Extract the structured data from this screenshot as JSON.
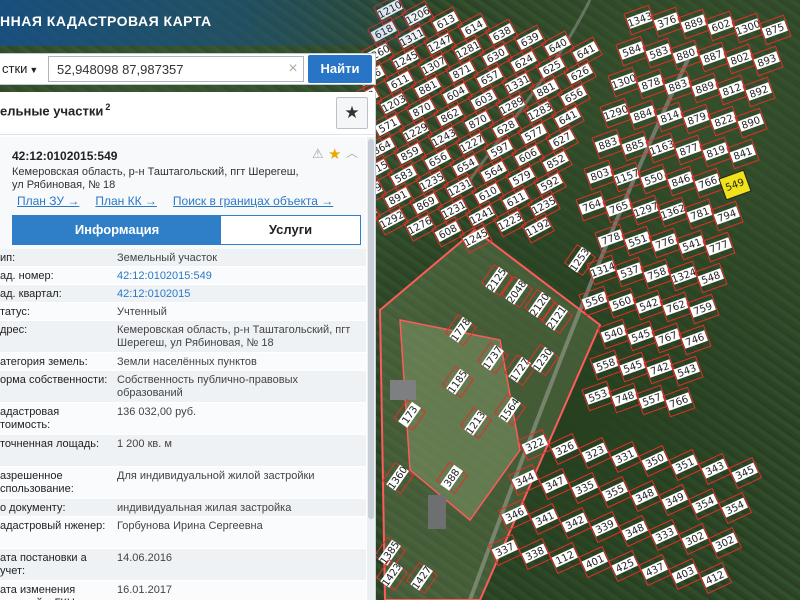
{
  "header": {
    "title": "ННАЯ КАДАСТРОВАЯ КАРТА"
  },
  "search": {
    "mode_label": "стки",
    "query": "52,948098 87,987357",
    "clear_icon": "close-icon",
    "find_label": "Найти"
  },
  "panel": {
    "title": "ельные участки",
    "count": "2",
    "favorite_icon": "star-icon"
  },
  "card": {
    "cad_number": "42:12:0102015:549",
    "address": "Кемеровская область, р-н Таштагольский, пгт Шерегеш, ул Рябиновая, № 18",
    "links": [
      "План ЗУ →",
      "План КК →",
      "Поиск в границах объекта →"
    ],
    "tabs": {
      "active": "Информация",
      "other": "Услуги"
    },
    "rows": [
      {
        "k": "ип:",
        "v": "Земельный участок",
        "h": 18
      },
      {
        "k": "ад. номер:",
        "v": "42:12:0102015:549",
        "h": 18,
        "link": true
      },
      {
        "k": "ад. квартал:",
        "v": "42:12:0102015",
        "h": 18,
        "link": true
      },
      {
        "k": "татус:",
        "v": "Учтенный",
        "h": 18
      },
      {
        "k": "дрес:",
        "v": "Кемеровская область, р-н Таштагольский, пгт Шерегеш, ул Рябиновая, № 18",
        "h": 32
      },
      {
        "k": "атегория земель:",
        "v": "Земли населённых пунктов",
        "h": 18
      },
      {
        "k": "орма собственности:",
        "v": "Собственность публично-правовых образований",
        "h": 32
      },
      {
        "k": "адастровая тоимость:",
        "v": "136 032,00 руб.",
        "h": 32
      },
      {
        "k": "точненная лощадь:",
        "v": "1 200 кв. м",
        "h": 32
      },
      {
        "k": "азрешенное спользование:",
        "v": "Для индивидуальной жилой застройки",
        "h": 32
      },
      {
        "k": "о документу:",
        "v": "индивидуальная жилая застройка",
        "h": 18
      },
      {
        "k": "адастровый нженер:",
        "v": "Горбунова Ирина Сергеевна",
        "h": 32
      },
      {
        "k": "ата постановки а учет:",
        "v": "14.06.2016",
        "h": 32
      },
      {
        "k": "ата изменения ведений в ГКН:",
        "v": "16.01.2017",
        "h": 32
      }
    ]
  },
  "map": {
    "highlight_color": "#f2e21a",
    "boundary_color": "#e0302c",
    "highlighted_plot": "549",
    "plots": [
      "1210",
      "1206",
      "613",
      "614",
      "638",
      "639",
      "640",
      "641",
      "618",
      "1311",
      "1247",
      "1281",
      "630",
      "624",
      "625",
      "626",
      "1260",
      "1245",
      "1307",
      "871",
      "657",
      "1331",
      "881",
      "656",
      "636",
      "611",
      "881",
      "604",
      "603",
      "1289",
      "1283",
      "641",
      "658",
      "1203",
      "870",
      "862",
      "870",
      "628",
      "577",
      "627",
      "1239",
      "571",
      "1229",
      "1243",
      "1227",
      "597",
      "606",
      "852",
      "1209",
      "864",
      "859",
      "656",
      "654",
      "564",
      "579",
      "592",
      "1228",
      "1215",
      "583",
      "1235",
      "1231",
      "610",
      "611",
      "1235",
      "420",
      "1269",
      "891",
      "869",
      "1231",
      "1241",
      "1223",
      "1192",
      "866",
      "1205",
      "1292",
      "1276",
      "608",
      "1245",
      "1233",
      "1239",
      "374",
      "360",
      "1226",
      "1244",
      "1216",
      "423",
      "379",
      "1250",
      "1311",
      "1297",
      "1313",
      "852",
      "1213",
      "1233",
      "1190",
      "1237",
      "1210",
      "1253",
      "1320",
      "1378",
      "1307",
      "1323",
      "1293",
      "1294",
      "1252",
      "1275",
      "1208",
      "1219",
      "1318",
      "1299",
      "1315",
      "1205",
      "1299",
      "1259",
      "1239",
      "1233",
      "1225",
      "1234",
      "1224",
      "1222",
      "1259",
      "1208",
      "1225",
      "1307",
      "1210",
      "1204",
      "1313",
      "1277",
      "254",
      "326",
      "357",
      "597",
      "592",
      "337",
      "313",
      "293",
      "330",
      "426",
      "381",
      "310",
      "209",
      "202",
      "255",
      "339",
      "1246",
      "1252",
      "1240",
      "241",
      "247",
      "303",
      "262",
      "214",
      "225",
      "205",
      "1212",
      "1309",
      "1211",
      "1303",
      "1283",
      "1265",
      "1203",
      "1263",
      "1201",
      "1298",
      "1206",
      "1213",
      "1290",
      "1264",
      "1222",
      "1219",
      "1202",
      "1212",
      "1209",
      "1308",
      "1203",
      "1210",
      "1267",
      "1271",
      "1214",
      "1221",
      "1236",
      "1290",
      "1242",
      "1221",
      "1280",
      "1266",
      "1260",
      "1292",
      "1244",
      "1205",
      "1308",
      "1307",
      "1327",
      "1311",
      "1239",
      "1204",
      "1231",
      "1213",
      "1238",
      "1226",
      "1296",
      "1284",
      "1205",
      "1233",
      "1274",
      "1314",
      "1251",
      "1320",
      "1316",
      "1302",
      "1318",
      "1270",
      "1219",
      "1327",
      "1280",
      "1256",
      "1300",
      "1212",
      "1269",
      "1222",
      "1297",
      "1249",
      "1273",
      "1317",
      "1302",
      "1295",
      "1315",
      "1276",
      "1315",
      "1211",
      "1322",
      "1282",
      "1278",
      "1230",
      "1276",
      "1252",
      "1201",
      "1205",
      "1288",
      "1230",
      "1296",
      "1275",
      "1306",
      "1294",
      "1244",
      "1322",
      "1234",
      "1300",
      "1254",
      "1303",
      "1298",
      "1279",
      "1233",
      "1242",
      "1220",
      "1211",
      "1284",
      "1304",
      "1281",
      "1319",
      "1221",
      "1272",
      "1211",
      "1284",
      "1241",
      "1263",
      "1291",
      "1237",
      "1277",
      "1263",
      "1216",
      "1305",
      "1216",
      "1277",
      "1319",
      "1241",
      "1231",
      "1280",
      "1227",
      "1267",
      "1252",
      "1295",
      "1235",
      "1283",
      "1296",
      "1270",
      "1254",
      "1287",
      "1225",
      "1205",
      "1283",
      "1284",
      "1244",
      "1219",
      "1283",
      "1313",
      "1306",
      "1317",
      "1261",
      "1224",
      "1316",
      "1223",
      "1256",
      "1237",
      "1243",
      "1293",
      "1307",
      "1251",
      "1267",
      "1259",
      "1263",
      "1226",
      "1308",
      "1278",
      "1291",
      "1209",
      "1213",
      "1219",
      "1235",
      "1269",
      "1281",
      "1225",
      "1279",
      "1270",
      "1206",
      "1234",
      "1289",
      "1306",
      "1262",
      "1224",
      "1216",
      "1294",
      "1301",
      "1261",
      "1291",
      "1269",
      "1213",
      "1301",
      "1233",
      "1266",
      "1244",
      "1214",
      "1239",
      "1228",
      "1246",
      "1264",
      "1248",
      "1210",
      "1231",
      "1299",
      "1218",
      "1324",
      "1241",
      "1244",
      "1223",
      "1280",
      "1300",
      "1215",
      "1300",
      "1293",
      "1236",
      "1228",
      "1218",
      "1256",
      "1227",
      "1228",
      "1319",
      "1222",
      "1318",
      "1266",
      "1224",
      "1264",
      "1321",
      "1233",
      "1326",
      "1229",
      "1206",
      "1234",
      "1285",
      "1295",
      "1224",
      "1243",
      "1221",
      "1260"
    ],
    "east_plots": [
      "1343",
      "376",
      "889",
      "602",
      "1300",
      "875",
      "584",
      "583",
      "880",
      "887",
      "802",
      "893",
      "1300",
      "878",
      "883",
      "889",
      "812",
      "892",
      "1290",
      "884",
      "814",
      "879",
      "822",
      "890",
      "883",
      "885",
      "1163",
      "877",
      "819",
      "841",
      "803",
      "1157",
      "550",
      "846",
      "766",
      "549",
      "764",
      "765",
      "1297",
      "1362",
      "781",
      "794",
      "548",
      "778",
      "551",
      "776",
      "541",
      "777",
      "549",
      "1314",
      "537",
      "758",
      "1324",
      "548",
      "775",
      "556",
      "560",
      "542",
      "762",
      "759",
      "769",
      "766",
      "540",
      "545",
      "767",
      "746",
      "764",
      "1326",
      "558",
      "545",
      "742",
      "543",
      "542",
      "785",
      "553",
      "748",
      "557",
      "766",
      "552",
      "747"
    ],
    "south_plots": [
      "322",
      "326",
      "323",
      "331",
      "350",
      "351",
      "343",
      "345",
      "344",
      "347",
      "335",
      "355",
      "348",
      "349",
      "354",
      "354",
      "346",
      "341",
      "342",
      "339",
      "348",
      "333",
      "302",
      "302",
      "337",
      "338",
      "112",
      "401",
      "425",
      "437",
      "403",
      "412"
    ],
    "special_plots": [
      "173",
      "1185",
      "1213",
      "1360",
      "388",
      "1385",
      "1423",
      "1427",
      "2125",
      "2048",
      "2120",
      "2121",
      "1778",
      "1737",
      "1727",
      "1564",
      "1230",
      "1253"
    ]
  }
}
